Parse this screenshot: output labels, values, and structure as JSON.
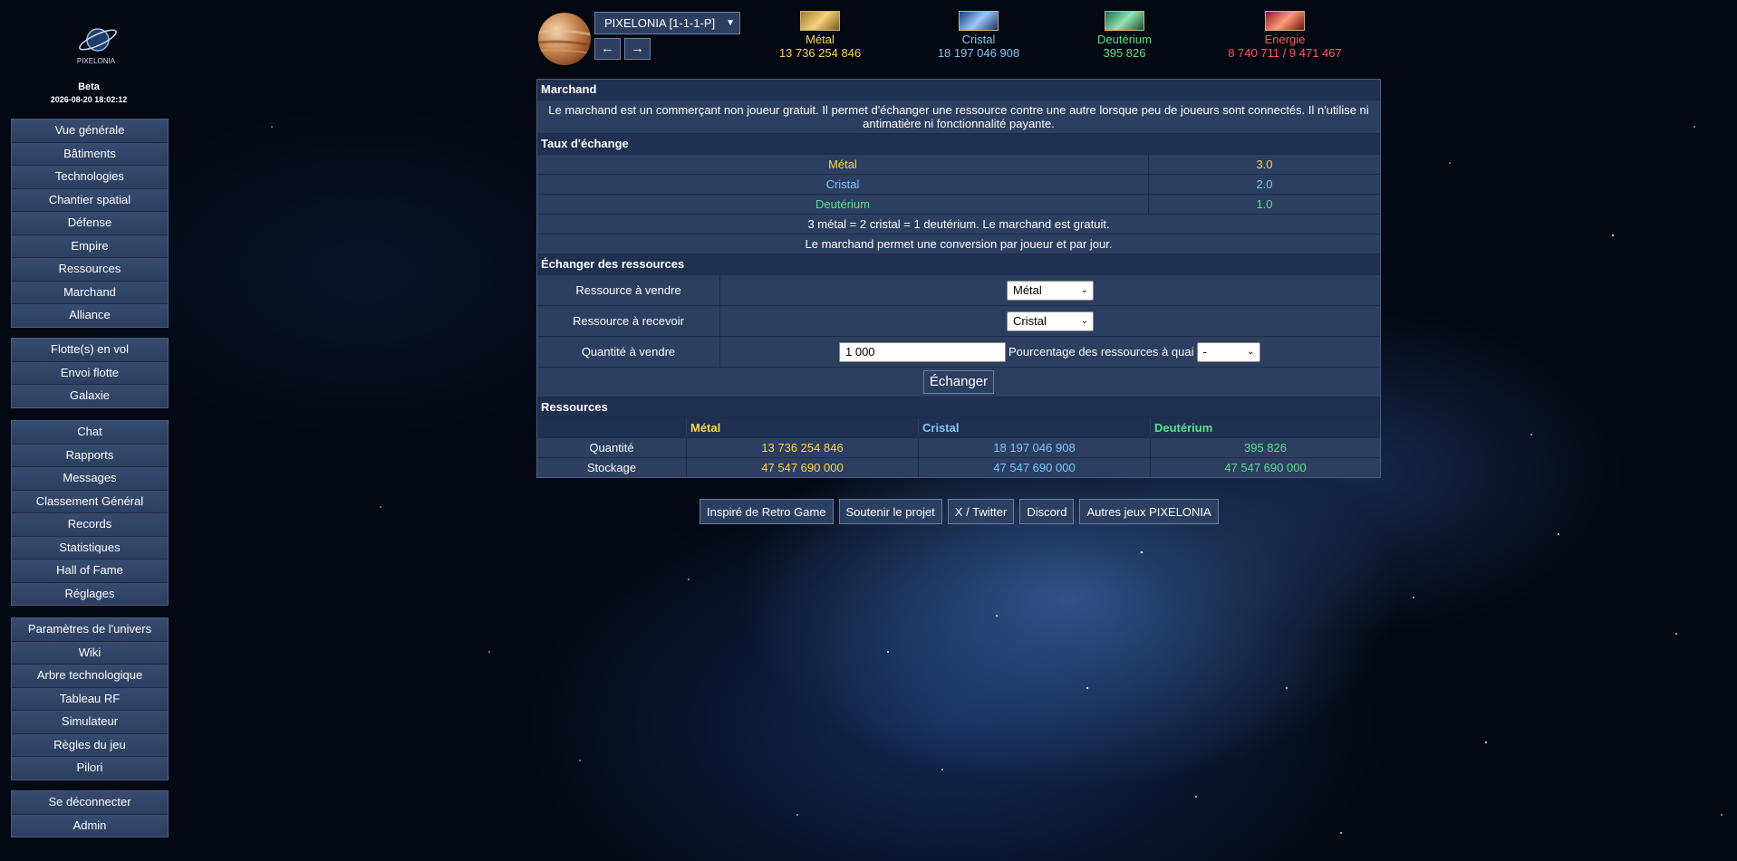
{
  "sidebar": {
    "logo_text": "PIXELONIA",
    "beta": "Beta",
    "datetime": "2026-08-20 18:02:12",
    "group1": [
      "Vue générale",
      "Bâtiments",
      "Technologies",
      "Chantier spatial",
      "Défense",
      "Empire",
      "Ressources",
      "Marchand",
      "Alliance"
    ],
    "group2": [
      "Flotte(s) en vol",
      "Envoi flotte",
      "Galaxie"
    ],
    "group3": [
      "Chat",
      "Rapports",
      "Messages",
      "Classement Général",
      "Records",
      "Statistiques",
      "Hall of Fame",
      "Réglages"
    ],
    "group4": [
      "Paramètres de l'univers",
      "Wiki",
      "Arbre technologique",
      "Tableau RF",
      "Simulateur",
      "Règles du jeu",
      "Pilori"
    ],
    "group5": [
      "Se déconnecter",
      "Admin"
    ]
  },
  "header": {
    "planet": "PIXELONIA [1-1-1-P]",
    "prev": "←",
    "next": "→",
    "resources": {
      "metal": {
        "label": "Métal",
        "value": "13 736 254 846"
      },
      "cristal": {
        "label": "Cristal",
        "value": "18 197 046 908"
      },
      "deuterium": {
        "label": "Deutérium",
        "value": "395 826"
      },
      "energie": {
        "label": "Energie",
        "value": "8 740 711 / 9 471 467"
      }
    }
  },
  "merchant": {
    "title": "Marchand",
    "description": "Le marchand est un commerçant non joueur gratuit. Il permet d'échanger une ressource contre une autre lorsque peu de joueurs sont connectés. Il n'utilise ni antimatière ni fonctionnalité payante.",
    "rates_title": "Taux d'échange",
    "rates": [
      {
        "name": "Métal",
        "rate": "3.0"
      },
      {
        "name": "Cristal",
        "rate": "2.0"
      },
      {
        "name": "Deutérium",
        "rate": "1.0"
      }
    ],
    "rate_note": "3 métal = 2 cristal = 1 deutérium. Le marchand est gratuit.",
    "rate_note2": "Le marchand permet une conversion par joueur et par jour.",
    "exchange_title": "Échanger des ressources",
    "sell_label": "Ressource à vendre",
    "sell_value": "Métal",
    "receive_label": "Ressource à recevoir",
    "receive_value": "Cristal",
    "qty_label": "Quantité à vendre",
    "qty_value": "1 000",
    "pct_label": "Pourcentage des ressources à quai",
    "pct_value": "-",
    "exchange_button": "Échanger",
    "res_title": "Ressources",
    "res_headers": [
      "Métal",
      "Cristal",
      "Deutérium"
    ],
    "res_rows": [
      {
        "label": "Quantité",
        "values": [
          "13 736 254 846",
          "18 197 046 908",
          "395 826"
        ]
      },
      {
        "label": "Stockage",
        "values": [
          "47 547 690 000",
          "47 547 690 000",
          "47 547 690 000"
        ]
      }
    ]
  },
  "footer": [
    "Inspiré de Retro Game",
    "Soutenir le projet",
    "X / Twitter",
    "Discord",
    "Autres jeux PIXELONIA"
  ],
  "colors": {
    "metal": "#ffd54f",
    "cristal": "#7ec8ff",
    "deuterium": "#5be08e",
    "energie": "#ff5a5a"
  }
}
